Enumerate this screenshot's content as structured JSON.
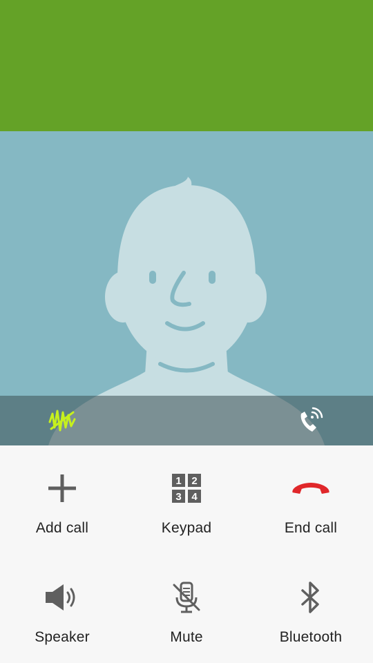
{
  "screen": {
    "accent_color": "#64a227",
    "photo_background": "#85b8c3",
    "end_call_color": "#e0272a",
    "noise_reduction_color": "#c6f01e"
  },
  "status_strip": {
    "left_icon": "noise-reduction-icon",
    "right_icon": "hd-voice-call-icon"
  },
  "controls": [
    {
      "label": "Add call",
      "icon": "plus-icon"
    },
    {
      "label": "Keypad",
      "icon": "keypad-icon",
      "keys": [
        "1",
        "2",
        "3",
        "4"
      ]
    },
    {
      "label": "End call",
      "icon": "end-call-icon"
    },
    {
      "label": "Speaker",
      "icon": "speaker-icon"
    },
    {
      "label": "Mute",
      "icon": "mute-microphone-icon"
    },
    {
      "label": "Bluetooth",
      "icon": "bluetooth-icon"
    }
  ]
}
